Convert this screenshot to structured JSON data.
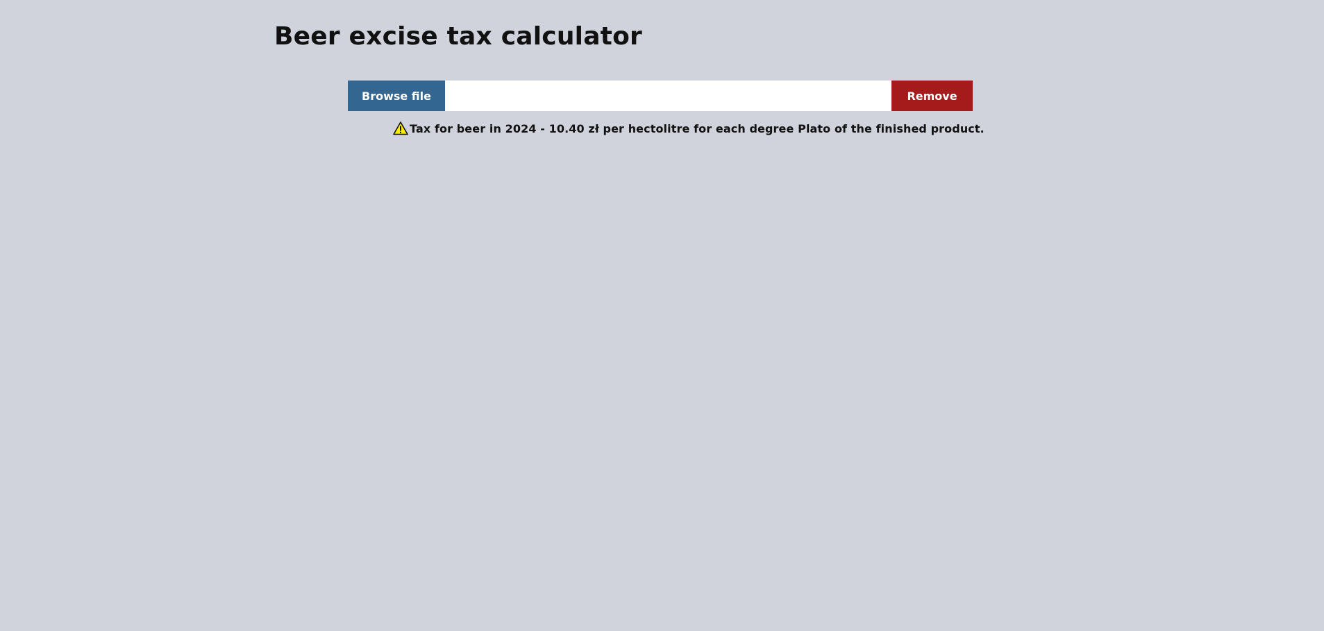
{
  "page": {
    "title": "Beer excise tax calculator"
  },
  "file_picker": {
    "browse_label": "Browse file",
    "file_name_value": "",
    "remove_label": "Remove"
  },
  "notice": {
    "icon": "warning-icon",
    "text": "Tax for beer in 2024 - 10.40 zł per hectolitre for each degree Plato of the finished product."
  },
  "colors": {
    "background": "#d0d3db",
    "browse_button": "#336791",
    "remove_button": "#a51a1a",
    "warning_fill": "#ffee00"
  }
}
